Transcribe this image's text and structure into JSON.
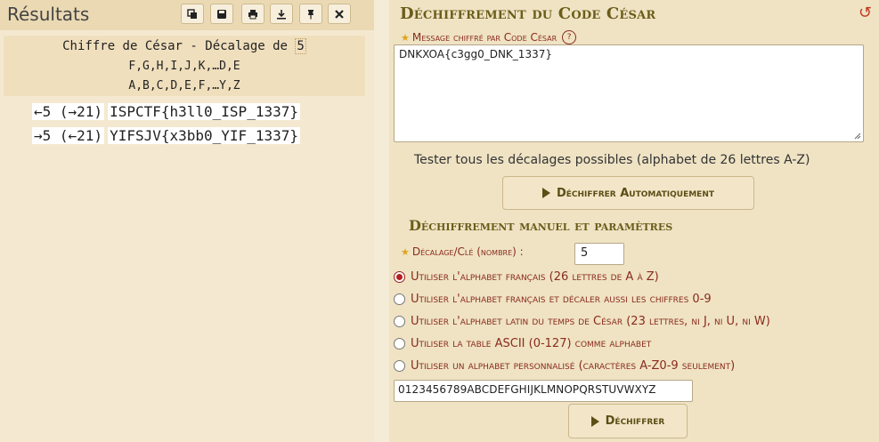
{
  "results_panel": {
    "title": "Résultats",
    "toolbar": [
      {
        "name": "copy",
        "icon": "copy-icon"
      },
      {
        "name": "save",
        "icon": "save-icon"
      },
      {
        "name": "print",
        "icon": "print-icon"
      },
      {
        "name": "download",
        "icon": "download-icon"
      },
      {
        "name": "pin",
        "icon": "pin-icon"
      },
      {
        "name": "close",
        "icon": "close-icon"
      }
    ],
    "caption_prefix": "Chiffre de César - Décalage de ",
    "caption_shift": "5",
    "alphabet_shifted": "F,G,H,I,J,K,…D,E",
    "alphabet_plain": "A,B,C,D,E,F,…Y,Z",
    "results": [
      {
        "shift_label": "←5 (→21)",
        "text": "ISPCTF{h3ll0_ISP_1337}"
      },
      {
        "shift_label": "→5 (←21)",
        "text": "YIFSJV{x3bb0_YIF_1337}"
      }
    ]
  },
  "decoder": {
    "title": "Déchiffrement du Code César",
    "message_label": "Message chiffré par Code César",
    "message_value": "DNKXOA{c3gg0_DNK_1337}",
    "test_all_text": "Tester tous les décalages possibles (alphabet de 26 lettres A-Z)",
    "auto_button_label": "Déchiffrer Automatiquement",
    "manual_title": "Déchiffrement manuel et paramètres",
    "key_label": "Décalage/Clé (nombre) :",
    "key_value": "5",
    "options": [
      {
        "label": "Utiliser l'alphabet français (26 lettres de A à Z)",
        "selected": true
      },
      {
        "label": "Utiliser l'alphabet français et décaler aussi les chiffres 0-9",
        "selected": false
      },
      {
        "label": "Utiliser l'alphabet latin du temps de César (23 lettres, ni J, ni U, ni W)",
        "selected": false
      },
      {
        "label": "Utiliser la table ASCII (0-127) comme alphabet",
        "selected": false
      },
      {
        "label": "Utiliser un alphabet personnalisé (caractères A-Z0-9 seulement)",
        "selected": false
      }
    ],
    "custom_alphabet": "0123456789ABCDEFGHIJKLMNOPQRSTUVWXYZ",
    "decrypt_button_label": "Déchiffrer"
  },
  "colors": {
    "accent_title": "#6b5d1a",
    "label_red": "#8a2b1c",
    "panel_bg": "#efe3c4"
  }
}
